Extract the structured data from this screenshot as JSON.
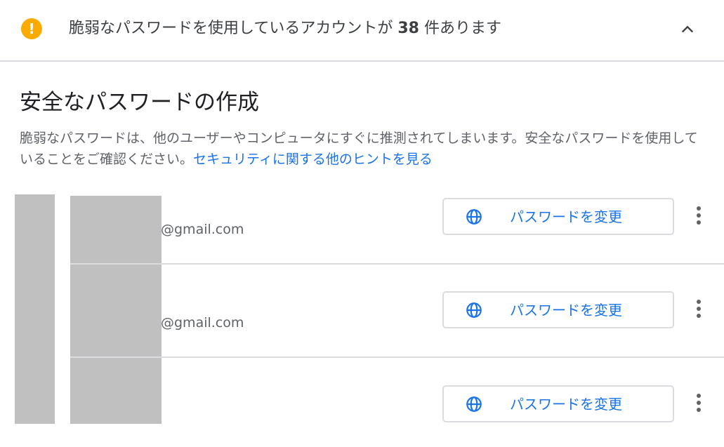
{
  "header": {
    "warning_icon": "exclamation-icon",
    "warning_color": "#f9ab00",
    "text_before": "脆弱なパスワードを使用しているアカウントが ",
    "count": "38",
    "text_after": " 件あります",
    "collapse_icon": "chevron-up-icon"
  },
  "section": {
    "title": "安全なパスワードの作成",
    "description": "脆弱なパスワードは、他のユーザーやコンピュータにすぐに推測されてしまいます。安全なパスワードを使用していることをご確認ください。",
    "link_text": "セキュリティに関する他のヒントを見る"
  },
  "accounts": [
    {
      "email": "@gmail.com",
      "button_label": "パスワードを変更",
      "button_icon": "globe-icon",
      "menu_icon": "more-vert-icon"
    },
    {
      "email": "@gmail.com",
      "button_label": "パスワードを変更",
      "button_icon": "globe-icon",
      "menu_icon": "more-vert-icon"
    },
    {
      "email": "",
      "button_label": "パスワードを変更",
      "button_icon": "globe-icon",
      "menu_icon": "more-vert-icon"
    }
  ],
  "colors": {
    "accent": "#1a73e8",
    "divider": "#dadce0",
    "redaction": "#c0c0c0"
  }
}
